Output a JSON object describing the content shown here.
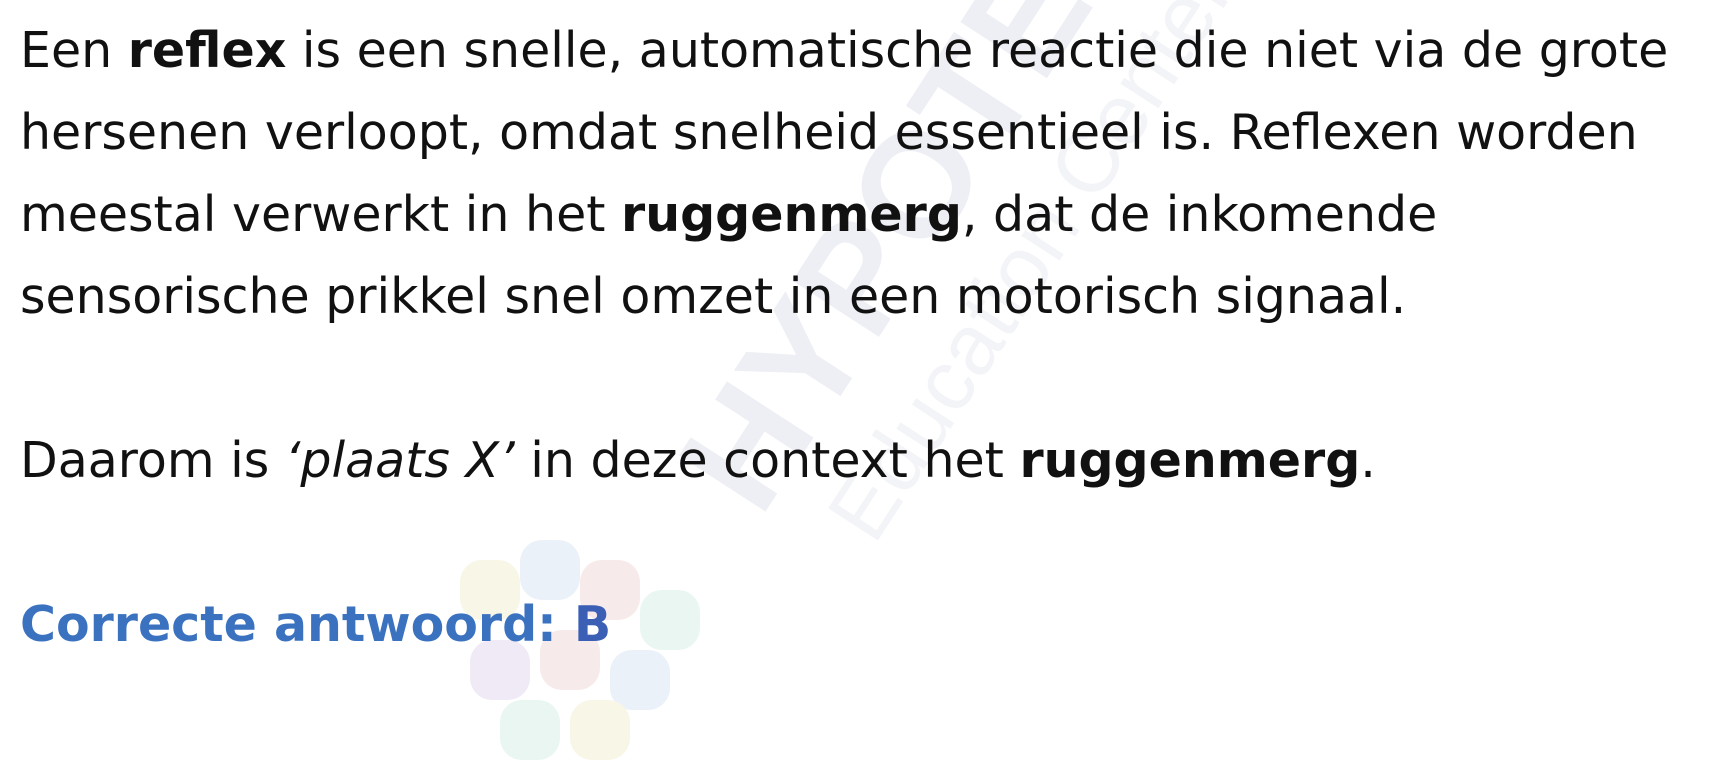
{
  "watermark": {
    "brand": "HYPOTENUSE",
    "sub": "Education Center",
    "colors": [
      "#e9ebf2",
      "#f2d9d9",
      "#d9e6f3",
      "#f3efd4",
      "#e4d9f0",
      "#d8efe6"
    ]
  },
  "paragraph1": {
    "t1": "Een ",
    "b1": "reflex",
    "t2": " is een snelle, automatische reactie die niet via de grote hersenen verloopt, omdat snelheid essentieel is. Reflexen worden meestal verwerkt in het ",
    "b2": "ruggenmerg",
    "t3": ", dat de inkomende sensorische prikkel snel omzet in een motorisch signaal."
  },
  "paragraph2": {
    "t1": "Daarom is ",
    "i1": "‘plaats X’",
    "t2": " in deze context het ",
    "b1": "ruggenmerg",
    "t3": "."
  },
  "answer": {
    "label": "Correcte antwoord: ",
    "letter": "B"
  }
}
